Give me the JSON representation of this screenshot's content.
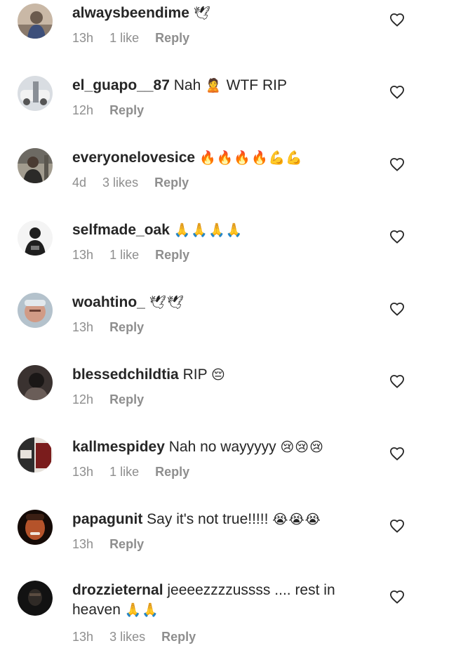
{
  "comments": [
    {
      "username": "alwaysbeendime",
      "text": "",
      "emoji": "🕊",
      "time": "13h",
      "likes": "1 like",
      "reply": "Reply",
      "avatar_colors": [
        "#c9b8a6",
        "#6b5b4e",
        "#3d4f7a"
      ]
    },
    {
      "username": "el_guapo__87",
      "text": "Nah",
      "emoji": "🙎",
      "text2": "WTF RIP",
      "time": "12h",
      "likes": "",
      "reply": "Reply",
      "avatar_colors": [
        "#d9dde2",
        "#f2f2f2",
        "#8a8f96"
      ]
    },
    {
      "username": "everyonelovesice",
      "text": "",
      "emoji": "🔥🔥🔥🔥💪💪",
      "time": "4d",
      "likes": "3 likes",
      "reply": "Reply",
      "avatar_colors": [
        "#6d6a63",
        "#2b2a28",
        "#a29c8f"
      ]
    },
    {
      "username": "selfmade_oak",
      "text": "",
      "emoji": "🙏🙏🙏🙏",
      "time": "13h",
      "likes": "1 like",
      "reply": "Reply",
      "avatar_colors": [
        "#f4f4f4",
        "#1e1e1e",
        "#777777"
      ]
    },
    {
      "username": "woahtino_",
      "text": "",
      "emoji": "🕊🕊",
      "time": "13h",
      "likes": "",
      "reply": "Reply",
      "avatar_colors": [
        "#b4c2cc",
        "#d19b86",
        "#e2e8ec"
      ]
    },
    {
      "username": "blessedchildtia",
      "text": "RIP",
      "emoji": "😔",
      "time": "12h",
      "likes": "",
      "reply": "Reply",
      "avatar_colors": [
        "#3a3230",
        "#1a1716",
        "#6a5d58"
      ]
    },
    {
      "username": "kallmespidey",
      "text": "Nah no wayyyyy",
      "emoji": "😢😢😢",
      "time": "13h",
      "likes": "1 like",
      "reply": "Reply",
      "avatar_colors": [
        "#7a1c1c",
        "#e7e2dc",
        "#2d2d2d"
      ]
    },
    {
      "username": "papagunit",
      "text": "Say it's not true!!!!!",
      "emoji": "😭😭😭",
      "time": "13h",
      "likes": "",
      "reply": "Reply",
      "avatar_colors": [
        "#3b1f14",
        "#b5532a",
        "#150b07"
      ]
    },
    {
      "username": "drozzieternal",
      "text": "jeeeezzzzussss .... rest in heaven",
      "emoji": "🙏🙏",
      "time": "13h",
      "likes": "3 likes",
      "reply": "Reply",
      "avatar_colors": [
        "#121212",
        "#2f2a26",
        "#5a4c40"
      ]
    }
  ],
  "icons": {
    "like": "heart-outline-icon"
  },
  "colors": {
    "username": "#262626",
    "meta": "#8e8e8e",
    "heart": "#262626"
  }
}
